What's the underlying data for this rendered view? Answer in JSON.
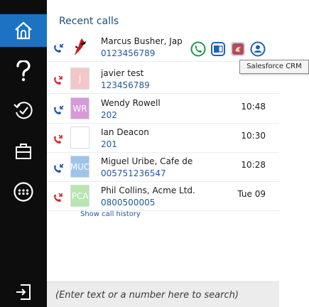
{
  "heading": "Recent calls",
  "colors": {
    "accent": "#1c73c4",
    "sidebar": "#0d0d0d",
    "missed": "#d6282b",
    "incoming": "#1f5aa0"
  },
  "calls": [
    {
      "direction": "incoming",
      "name": "Marcus Busher, Jap",
      "number": "0123456789",
      "time": "",
      "avatar_text": "",
      "avatar_color": "#ffffff",
      "avatar_type": "logo-red-figure"
    },
    {
      "direction": "missed",
      "name": "javier test",
      "number": "123456789",
      "time": "",
      "avatar_text": "J",
      "avatar_color": "#f3c7c7",
      "avatar_type": "initials"
    },
    {
      "direction": "incoming",
      "name": "Wendy Rowell",
      "number": "202",
      "time": "10:48",
      "avatar_text": "WR",
      "avatar_color": "#d79ad8",
      "avatar_type": "initials"
    },
    {
      "direction": "missed",
      "name": "Ian Deacon",
      "number": "201",
      "time": "10:30",
      "avatar_text": "",
      "avatar_color": "#ffffff",
      "avatar_type": "blank"
    },
    {
      "direction": "incoming",
      "name": "Miguel Uribe, Cafe de",
      "number": "005751236547",
      "time": "10:28",
      "avatar_text": "MUC",
      "avatar_color": "#9ec4ea",
      "avatar_type": "initials"
    },
    {
      "direction": "missed",
      "name": "Phil Collins, Acme Ltd.",
      "number": "0800500005",
      "time": "Tue 09",
      "avatar_text": "PCA",
      "avatar_color": "#b7e6b1",
      "avatar_type": "initials"
    }
  ],
  "row_actions": [
    {
      "icon": "phone-icon",
      "color": "#1a9a4a"
    },
    {
      "icon": "outlook-icon",
      "color": "#1e64b9"
    },
    {
      "icon": "salesforce-icon",
      "color": "#b54b5b"
    },
    {
      "icon": "contact-icon",
      "color": "#1e64b9"
    }
  ],
  "tooltip": "Salesforce CRM",
  "history_link": "Show call history",
  "search": {
    "placeholder": "(Enter text or a number here to search)"
  },
  "sidebar": {
    "items": [
      {
        "icon": "home-icon",
        "active": true
      },
      {
        "icon": "help-icon",
        "active": false
      },
      {
        "icon": "history-icon",
        "active": false
      },
      {
        "icon": "briefcase-icon",
        "active": false
      },
      {
        "icon": "dialpad-icon",
        "active": false
      },
      {
        "icon": "logout-icon",
        "active": false
      }
    ]
  }
}
